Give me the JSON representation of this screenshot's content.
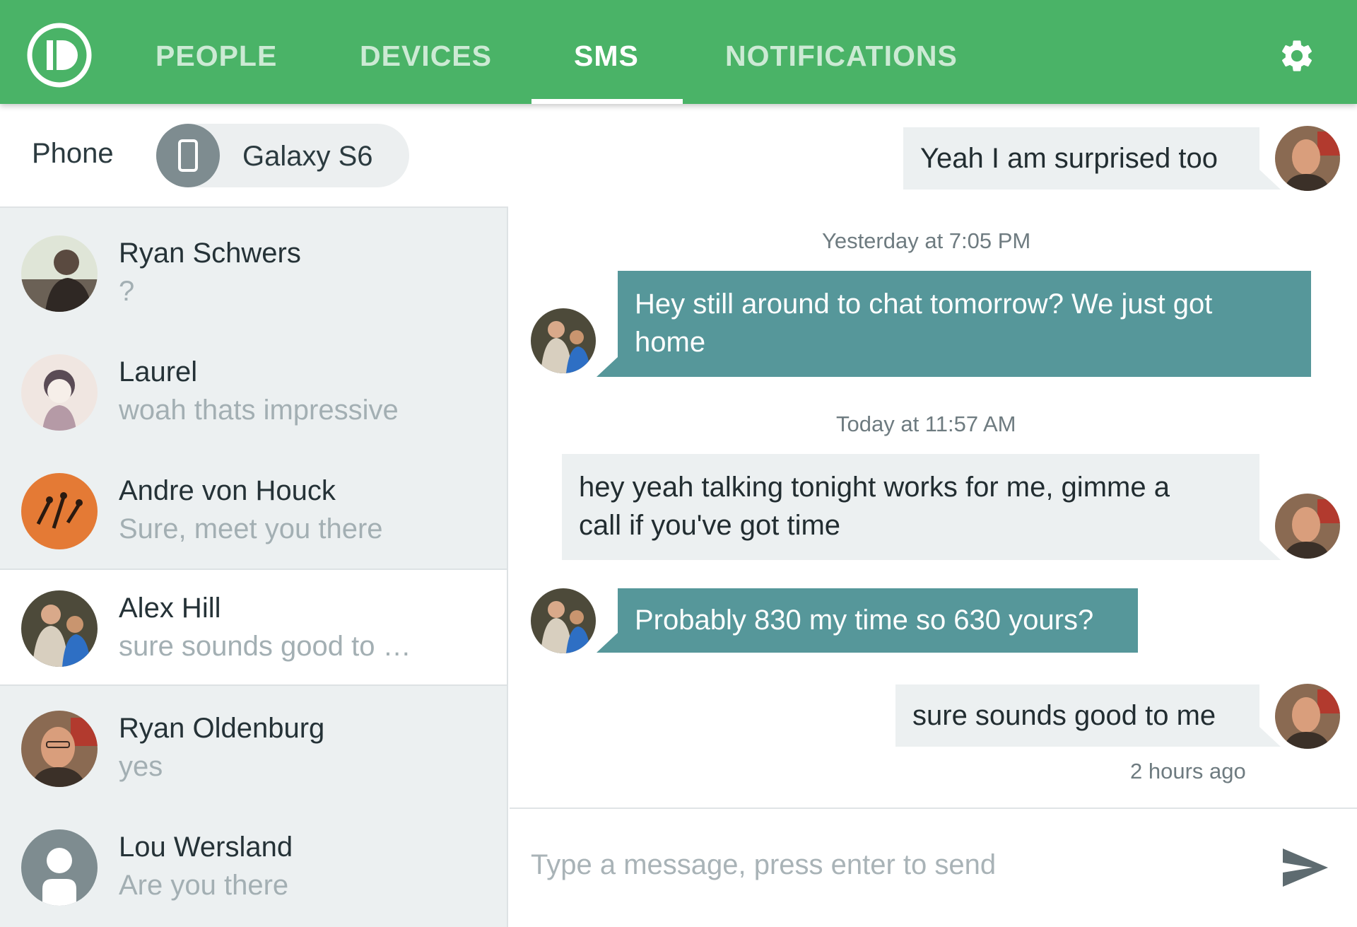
{
  "colors": {
    "brand_green": "#4ab367",
    "incoming_bubble": "#56979a",
    "outgoing_bubble": "#ecf0f1",
    "sidebar_bg": "#ecf0f1"
  },
  "header": {
    "logo_icon": "pushbullet-logo-icon",
    "tabs": [
      {
        "label": "PEOPLE",
        "active": false
      },
      {
        "label": "DEVICES",
        "active": false
      },
      {
        "label": "SMS",
        "active": true
      },
      {
        "label": "NOTIFICATIONS",
        "active": false
      }
    ],
    "settings_icon": "gear-icon"
  },
  "sidebar": {
    "phone_label": "Phone",
    "device": {
      "name": "Galaxy S6",
      "icon": "smartphone-icon"
    },
    "contacts": [
      {
        "name": "Ryan Schwers",
        "last_message": "?",
        "selected": false
      },
      {
        "name": "Laurel",
        "last_message": "woah thats impressive",
        "selected": false
      },
      {
        "name": "Andre von Houck",
        "last_message": "Sure, meet you there",
        "selected": false
      },
      {
        "name": "Alex Hill",
        "last_message": "sure sounds good to …",
        "selected": true
      },
      {
        "name": "Ryan Oldenburg",
        "last_message": "yes",
        "selected": false
      },
      {
        "name": "Lou Wersland",
        "last_message": "Are you there",
        "selected": false
      }
    ]
  },
  "conversation": {
    "messages": [
      {
        "direction": "out",
        "lines": [
          "Yeah I am surprised too"
        ]
      },
      {
        "direction": "in",
        "lines": [
          "Hey still around to chat tomorrow? We just got",
          "home"
        ]
      },
      {
        "direction": "out",
        "lines": [
          "hey yeah talking tonight works for me, gimme a",
          "call if you've got time"
        ]
      },
      {
        "direction": "in",
        "lines": [
          "Probably 830 my time so 630 yours?"
        ]
      },
      {
        "direction": "out",
        "lines": [
          "sure sounds good to me"
        ]
      }
    ],
    "timestamps": [
      "Yesterday at 7:05 PM",
      "Today at 11:57 AM"
    ],
    "last_sent": "2 hours ago"
  },
  "composer": {
    "placeholder": "Type a message, press enter to send",
    "value": "",
    "send_icon": "send-icon"
  }
}
